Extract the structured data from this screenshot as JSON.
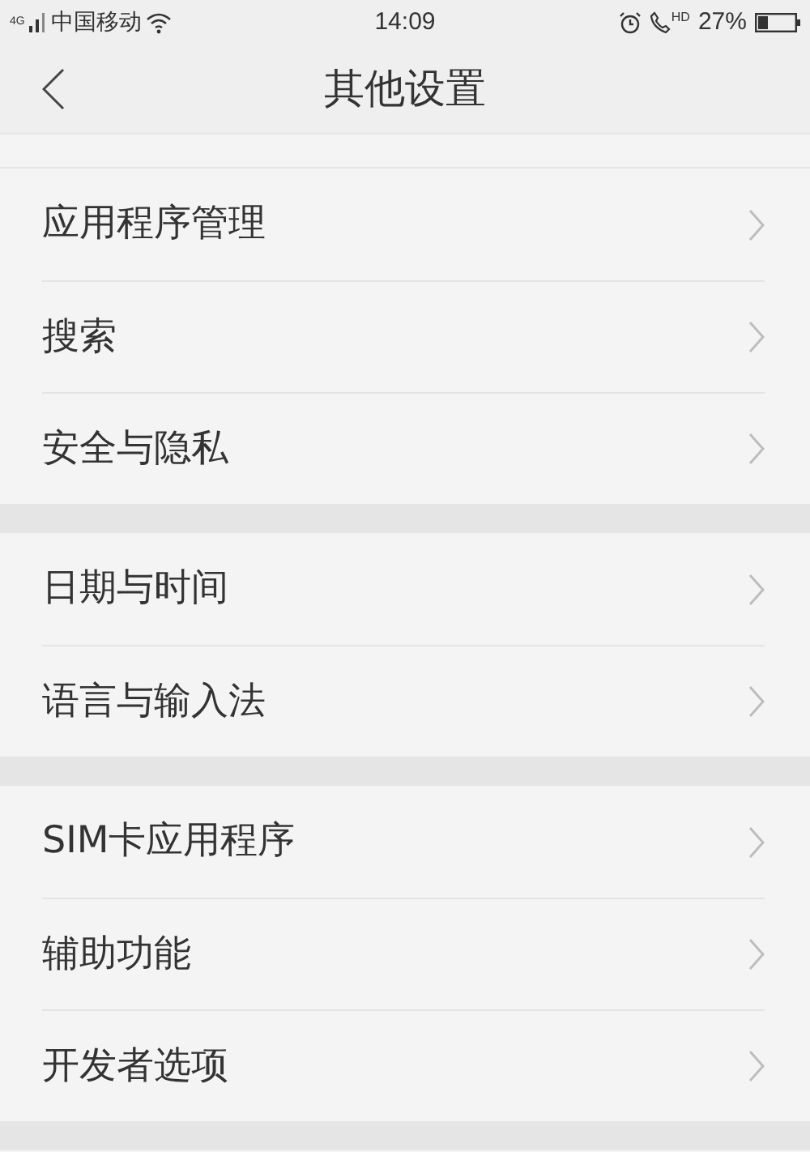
{
  "status_bar": {
    "network_type": "4G",
    "carrier": "中国移动",
    "time": "14:09",
    "call_badge": "HD",
    "battery": "27%"
  },
  "header": {
    "title": "其他设置"
  },
  "groups": [
    {
      "items": [
        {
          "label": "应用程序管理"
        },
        {
          "label": "搜索"
        },
        {
          "label": "安全与隐私"
        }
      ]
    },
    {
      "items": [
        {
          "label": "日期与时间"
        },
        {
          "label": "语言与输入法"
        }
      ]
    },
    {
      "items": [
        {
          "label": "SIM卡应用程序"
        },
        {
          "label": "辅助功能"
        },
        {
          "label": "开发者选项"
        }
      ]
    }
  ]
}
